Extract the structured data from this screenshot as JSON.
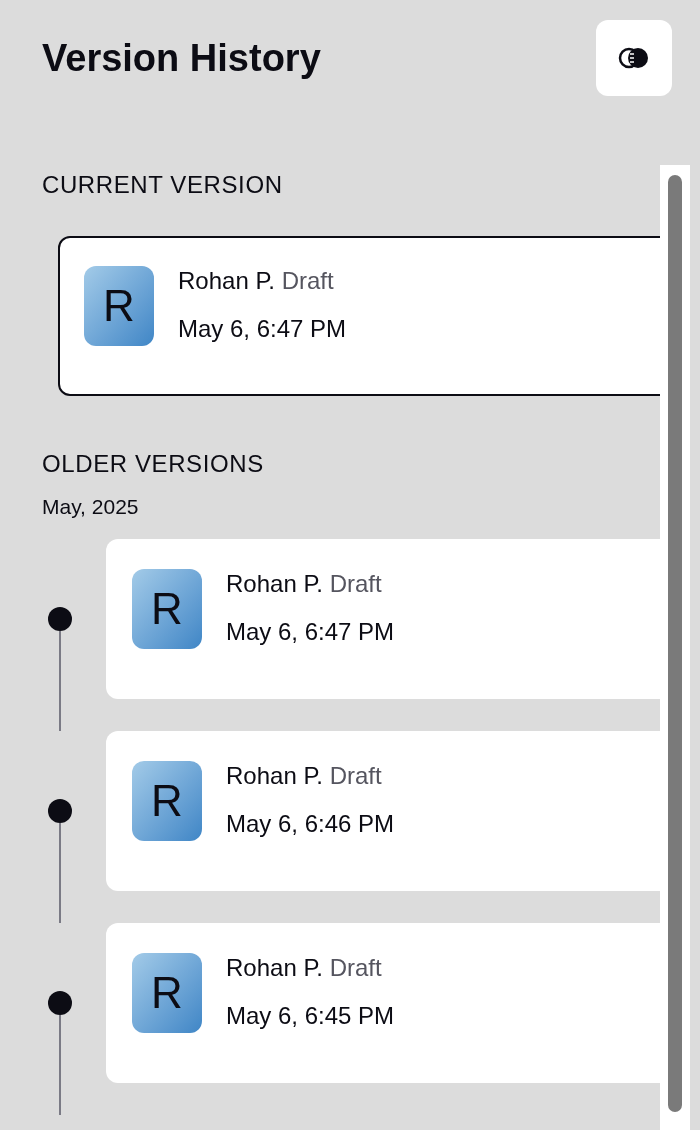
{
  "title": "Version History",
  "current": {
    "heading": "CURRENT VERSION",
    "version": {
      "initial": "R",
      "author": "Rohan P.",
      "status": "Draft",
      "time": "May 6, 6:47 PM"
    }
  },
  "older": {
    "heading": "OLDER VERSIONS",
    "groups": [
      {
        "label": "May, 2025",
        "versions": [
          {
            "initial": "R",
            "author": "Rohan P.",
            "status": "Draft",
            "time": "May 6, 6:47 PM"
          },
          {
            "initial": "R",
            "author": "Rohan P.",
            "status": "Draft",
            "time": "May 6, 6:46 PM"
          },
          {
            "initial": "R",
            "author": "Rohan P.",
            "status": "Draft",
            "time": "May 6, 6:45 PM"
          }
        ]
      }
    ]
  }
}
